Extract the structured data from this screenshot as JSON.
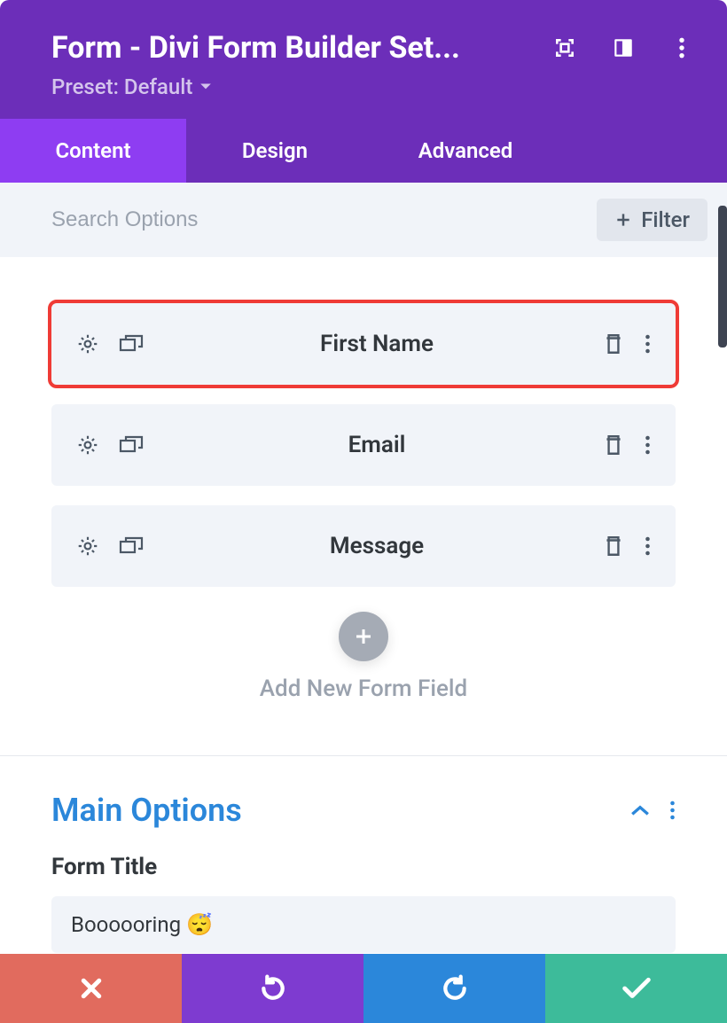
{
  "header": {
    "title": "Form - Divi Form Builder Set...",
    "preset_label": "Preset: Default"
  },
  "tabs": {
    "content": "Content",
    "design": "Design",
    "advanced": "Advanced"
  },
  "search": {
    "placeholder": "Search Options",
    "filter_label": "Filter"
  },
  "fields": [
    {
      "label": "First Name",
      "highlight": true
    },
    {
      "label": "Email",
      "highlight": false
    },
    {
      "label": "Message",
      "highlight": false
    }
  ],
  "add_field_label": "Add New Form Field",
  "section": {
    "title": "Main Options",
    "form_title_label": "Form Title",
    "form_title_value": "Boooooring 😴"
  }
}
